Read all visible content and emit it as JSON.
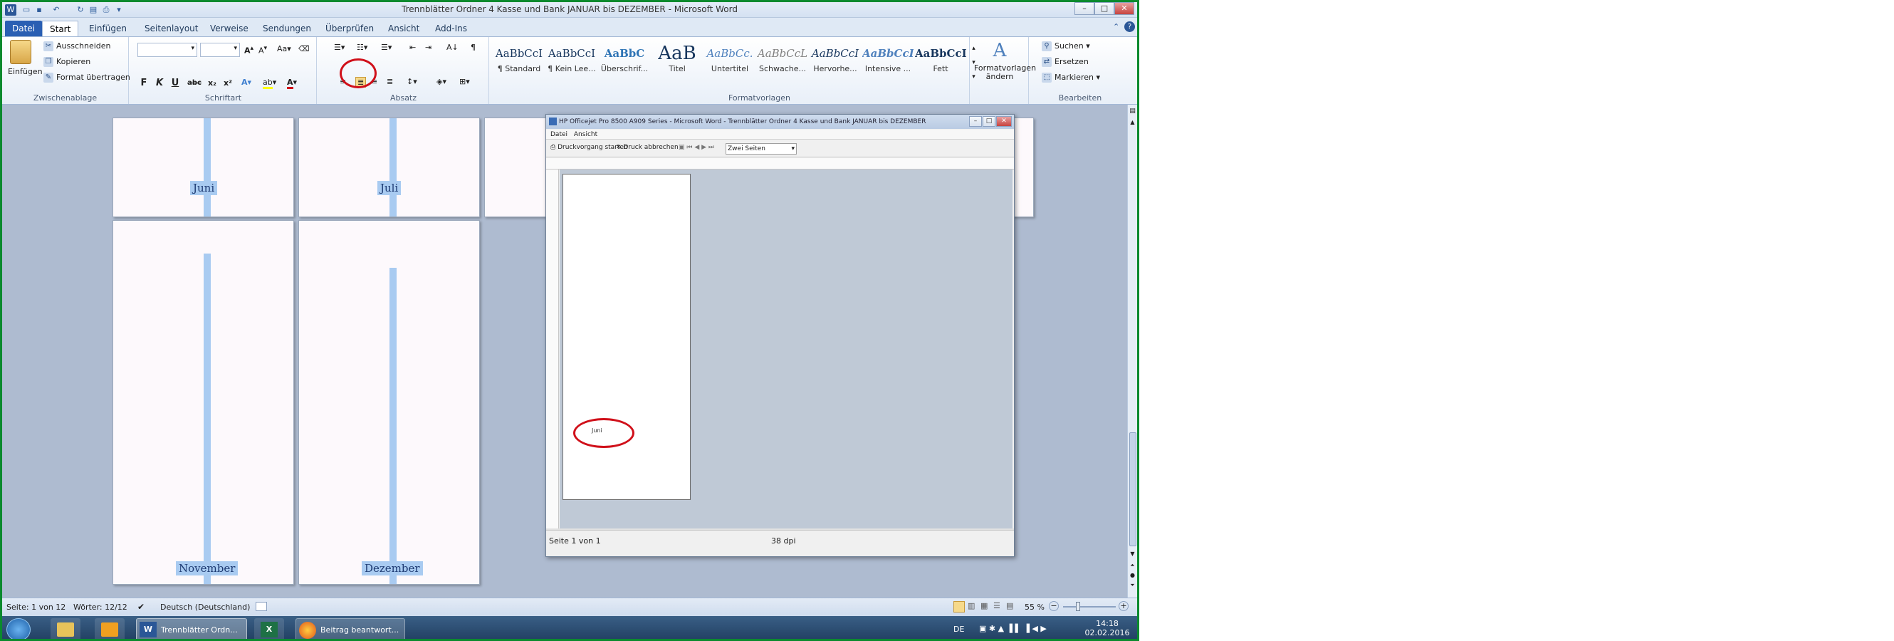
{
  "window": {
    "title": "Trennblätter Ordner 4 Kasse und Bank JANUAR bis DEZEMBER  -  Microsoft Word",
    "controls": [
      "–",
      "□",
      "✕"
    ]
  },
  "quick_access": {
    "icons": [
      "word-icon",
      "open-icon",
      "save-icon",
      "undo-icon",
      "redo-icon",
      "print-preview-icon",
      "print-icon",
      "customize-icon"
    ]
  },
  "tabs": [
    "Datei",
    "Start",
    "Einfügen",
    "Seitenlayout",
    "Verweise",
    "Sendungen",
    "Überprüfen",
    "Ansicht",
    "Add-Ins"
  ],
  "active_tab": "Start",
  "ribbon": {
    "clipboard": {
      "paste_label": "Einfügen",
      "cut_label": "Ausschneiden",
      "copy_label": "Kopieren",
      "format_painter_label": "Format übertragen",
      "group_label": "Zwischenablage"
    },
    "font": {
      "font_name": "",
      "font_size": "",
      "group_label": "Schriftart",
      "buttons": [
        "F",
        "K",
        "U",
        "abc",
        "x₂",
        "x²"
      ]
    },
    "paragraph": {
      "group_label": "Absatz"
    },
    "styles": {
      "group_label": "Formatvorlagen",
      "items": [
        {
          "sample": "AaBbCcI",
          "name": "¶ Standard"
        },
        {
          "sample": "AaBbCcI",
          "name": "¶ Kein Lee..."
        },
        {
          "sample": "AaBbC",
          "name": "Überschrif..."
        },
        {
          "sample": "AaB",
          "name": "Titel"
        },
        {
          "sample": "AaBbCc.",
          "name": "Untertitel"
        },
        {
          "sample": "AaBbCcL",
          "name": "Schwache..."
        },
        {
          "sample": "AaBbCcI",
          "name": "Hervorhe..."
        },
        {
          "sample": "AaBbCcI",
          "name": "Intensive ..."
        },
        {
          "sample": "AaBbCcI",
          "name": "Fett"
        }
      ],
      "change_styles_label": "Formatvorlagen ändern"
    },
    "editing": {
      "group_label": "Bearbeiten",
      "find_label": "Suchen",
      "replace_label": "Ersetzen",
      "select_label": "Markieren"
    }
  },
  "document": {
    "pages_top": [
      "Juni",
      "Juli"
    ],
    "pages_bottom": [
      "November",
      "Dezember"
    ]
  },
  "preview_window": {
    "title": "HP Officejet Pro 8500 A909 Series - Microsoft Word - Trennblätter Ordner 4 Kasse und Bank JANUAR bis DEZEMBER",
    "menu": [
      "Datei",
      "Ansicht"
    ],
    "toolbar_print": "Druckvorgang starten",
    "toolbar_close": "Druck abbrechen",
    "view_select": "Zwei Seiten",
    "page_text": "Juni",
    "status_left": "Seite 1 von 1",
    "status_center": "38 dpi"
  },
  "status": {
    "page": "Seite: 1 von 12",
    "words": "Wörter: 12/12",
    "language": "Deutsch (Deutschland)",
    "zoom": "55 %"
  },
  "taskbar": {
    "items": [
      {
        "icon": "windows-start-icon",
        "label": ""
      },
      {
        "icon": "explorer-icon",
        "label": ""
      },
      {
        "icon": "outlook-icon",
        "label": ""
      },
      {
        "icon": "word-icon",
        "label": "Trennblätter Ordn..."
      },
      {
        "icon": "excel-icon",
        "label": ""
      },
      {
        "icon": "firefox-icon",
        "label": "Beitrag beantwort..."
      }
    ],
    "lang": "DE",
    "time": "14:18",
    "date": "02.02.2016"
  },
  "colors": {
    "highlight": "#a9cbf1",
    "annotation_red": "#d0101a",
    "screen_border": "#0b8a2e"
  }
}
